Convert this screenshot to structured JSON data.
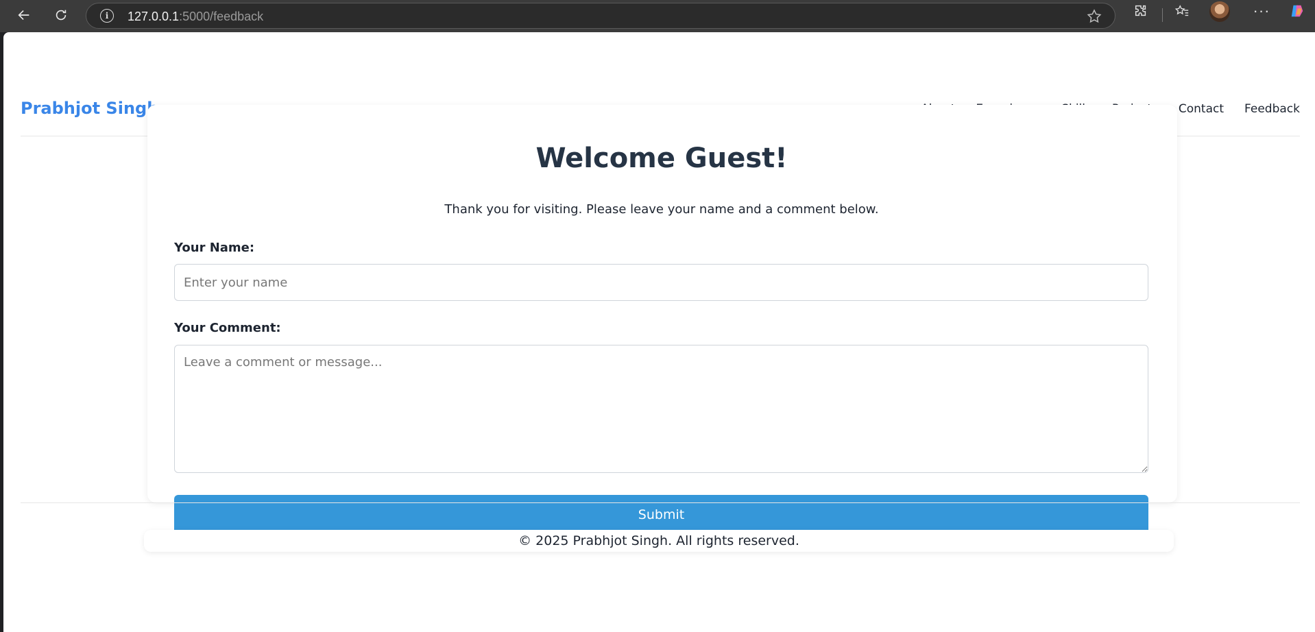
{
  "browser": {
    "url_host": "127.0.0.1",
    "url_path": ":5000/feedback",
    "icons": [
      "back-arrow-icon",
      "reload-icon",
      "info-icon",
      "star-icon",
      "extensions-icon",
      "favorites-icon",
      "profile-avatar",
      "more-icon",
      "copilot-icon"
    ]
  },
  "header": {
    "brand": "Prabhjot Singh",
    "nav": [
      "About",
      "Experience",
      "Skills",
      "Projects",
      "Contact",
      "Feedback"
    ],
    "brand_color": "#3a86e8"
  },
  "feedback": {
    "title": "Welcome Guest!",
    "intro": "Thank you for visiting. Please leave your name and a comment below.",
    "name_label": "Your Name:",
    "name_placeholder": "Enter your name",
    "name_value": "",
    "comment_label": "Your Comment:",
    "comment_placeholder": "Leave a comment or message...",
    "comment_value": "",
    "submit_label": "Submit",
    "submit_color": "#3597d9"
  },
  "footer": {
    "text": "© 2025 Prabhjot Singh. All rights reserved."
  }
}
